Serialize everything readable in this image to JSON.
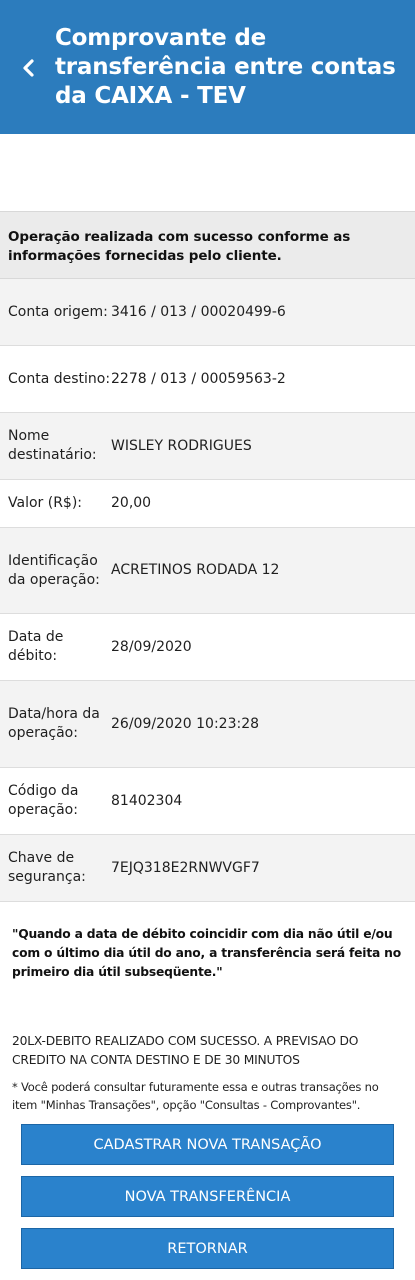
{
  "header": {
    "title": "Comprovante de transferência entre contas da CAIXA - TEV",
    "back_icon": "chevron-left-icon",
    "background": "#2c7cbd"
  },
  "success_message": "Operação realizada com sucesso conforme as informações fornecidas pelo cliente.",
  "details": [
    {
      "label": "Conta origem:",
      "value": "3416 / 013 / 00020499-6"
    },
    {
      "label": "Conta destino:",
      "value": "2278 / 013 / 00059563-2"
    },
    {
      "label": "Nome destinatário:",
      "value": "WISLEY RODRIGUES"
    },
    {
      "label": "Valor (R$):",
      "value": "20,00"
    },
    {
      "label": "Identificação da operação:",
      "value": "ACRETINOS RODADA 12"
    },
    {
      "label": "Data de débito:",
      "value": "28/09/2020"
    },
    {
      "label": "Data/hora da operação:",
      "value": "26/09/2020 10:23:28"
    },
    {
      "label": "Código da operação:",
      "value": "81402304"
    },
    {
      "label": "Chave de segurança:",
      "value": "7EJQ318E2RNWVGF7"
    }
  ],
  "notice": "\"Quando a data de débito coincidir com dia não útil e/ou com o último dia útil do ano, a transferência será feita no primeiro dia útil subseqüente.\"",
  "result_message": "20LX-DEBITO REALIZADO COM SUCESSO. A PREVISAO DO CREDITO NA CONTA DESTINO E DE 30 MINUTOS",
  "footnote": "* Você poderá consultar futuramente essa e outras transações no item \"Minhas Transações\", opção \"Consultas - Comprovantes\".",
  "buttons": {
    "new_transaction": "CADASTRAR NOVA TRANSAÇÃO",
    "new_transfer": "NOVA TRANSFERÊNCIA",
    "return": "RETORNAR"
  },
  "colors": {
    "button": "#2a82cc"
  }
}
